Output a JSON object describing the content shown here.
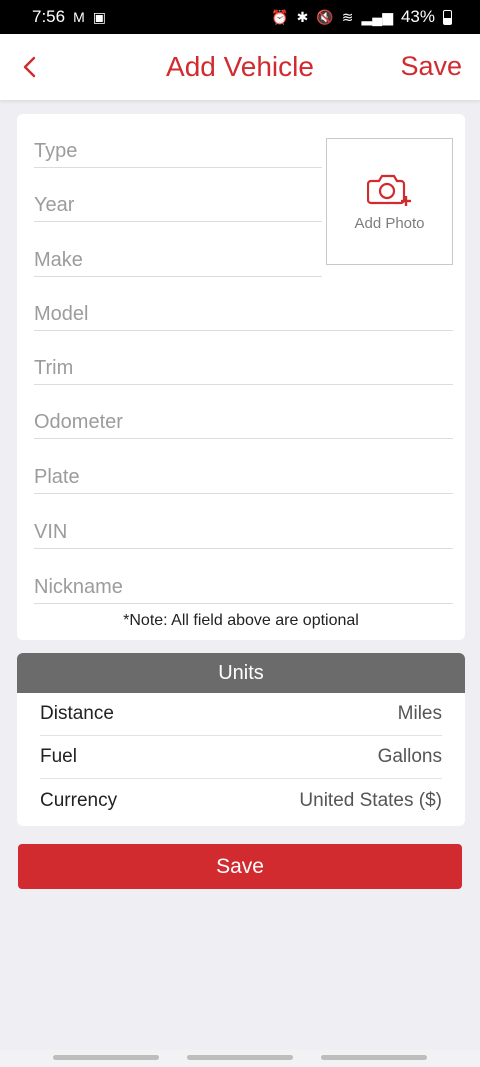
{
  "status_bar": {
    "time": "7:56",
    "battery": "43%"
  },
  "nav": {
    "title": "Add Vehicle",
    "save_label": "Save"
  },
  "form": {
    "fields": [
      {
        "placeholder": "Type"
      },
      {
        "placeholder": "Year"
      },
      {
        "placeholder": "Make"
      },
      {
        "placeholder": "Model"
      },
      {
        "placeholder": "Trim"
      },
      {
        "placeholder": "Odometer"
      },
      {
        "placeholder": "Plate"
      },
      {
        "placeholder": "VIN"
      },
      {
        "placeholder": "Nickname"
      }
    ],
    "add_photo_label": "Add Photo",
    "note": "*Note: All field above are optional"
  },
  "units": {
    "title": "Units",
    "rows": [
      {
        "label": "Distance",
        "value": "Miles"
      },
      {
        "label": "Fuel",
        "value": "Gallons"
      },
      {
        "label": "Currency",
        "value": "United States ($)"
      }
    ]
  },
  "save_button_label": "Save",
  "colors": {
    "accent": "#d12b2f",
    "units_header": "#6b6b6b",
    "background": "#efeef3"
  }
}
